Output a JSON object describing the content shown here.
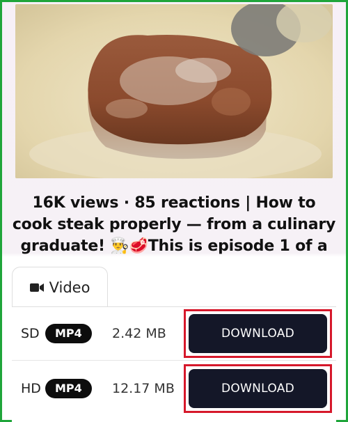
{
  "video": {
    "thumbnail_icon": "steak-thumbnail-image",
    "title": "16K views · 85 reactions | How to cook steak properly — from a culinary graduate! 👨‍🍳🥩This is episode 1 of a"
  },
  "tabs": [
    {
      "label": "Video",
      "icon": "video-camera-icon",
      "active": true
    }
  ],
  "downloads": [
    {
      "quality": "SD",
      "format": "MP4",
      "size": "2.42 MB",
      "button_label": "DOWNLOAD"
    },
    {
      "quality": "HD",
      "format": "MP4",
      "size": "12.17 MB",
      "button_label": "DOWNLOAD"
    }
  ],
  "colors": {
    "frame_border": "#1fa53a",
    "highlight": "#d6182b",
    "button_bg": "#141728"
  }
}
